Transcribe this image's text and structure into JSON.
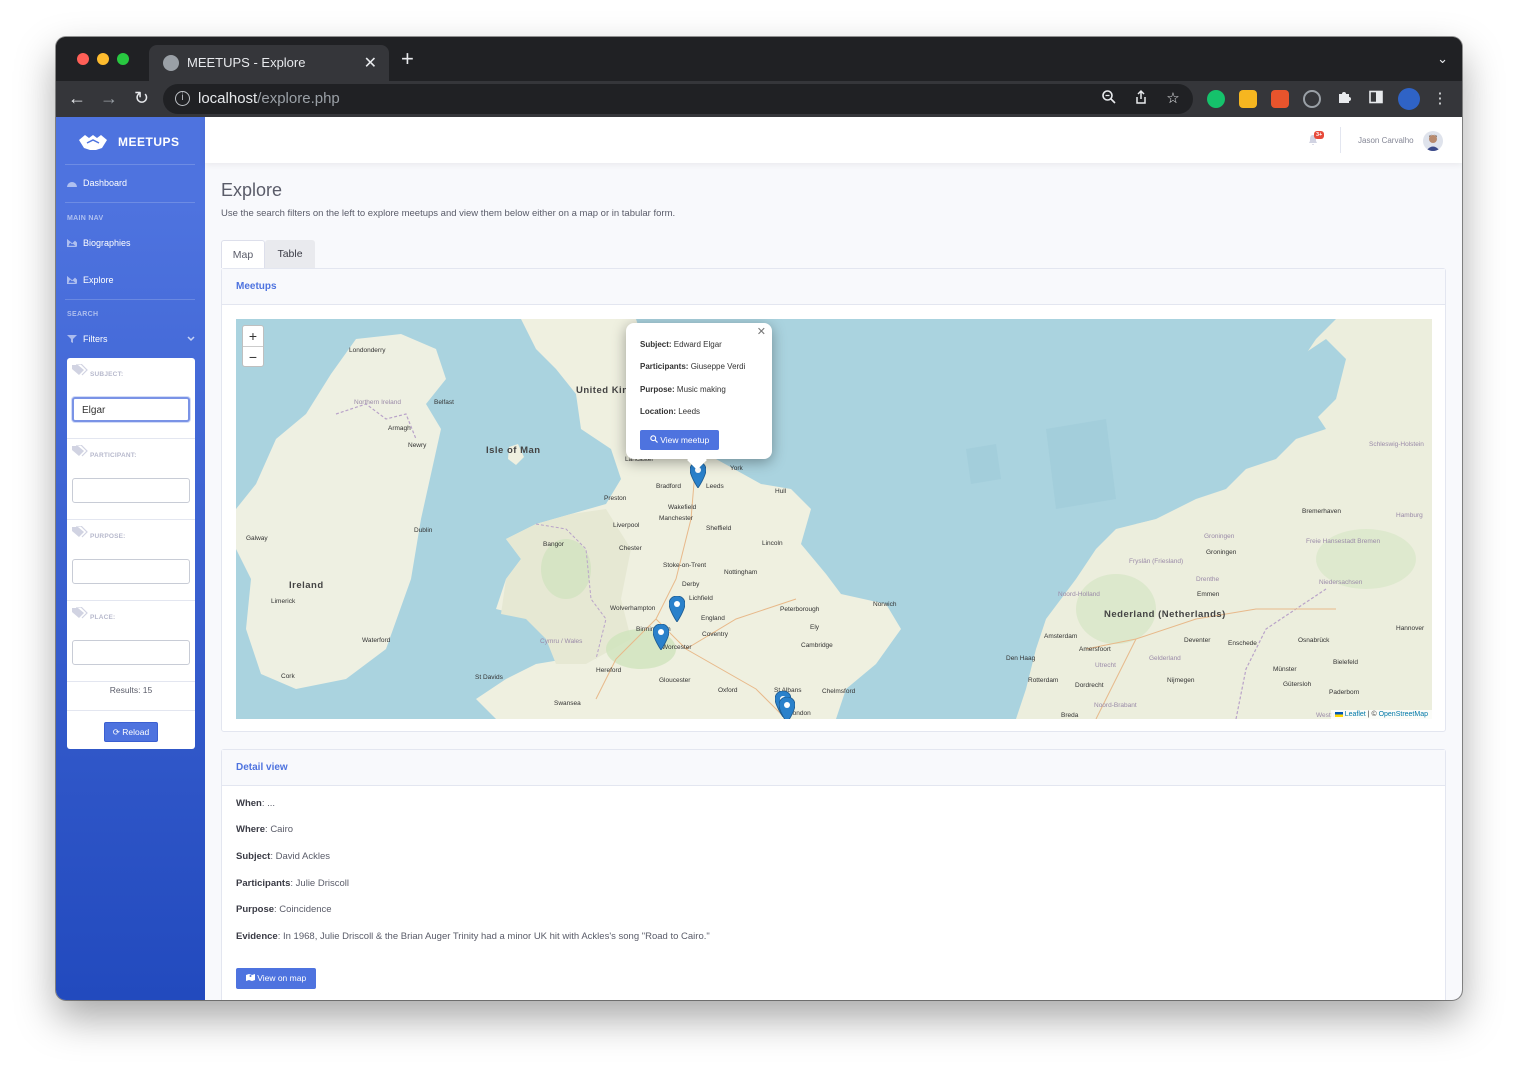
{
  "browser": {
    "tab_title": "MEETUPS - Explore",
    "url_host": "localhost",
    "url_path": "/explore.php"
  },
  "sidebar": {
    "brand": "MEETUPS",
    "dashboard": "Dashboard",
    "main_nav_heading": "MAIN NAV",
    "biographies": "Biographies",
    "explore": "Explore",
    "search_heading": "SEARCH",
    "filters": "Filters",
    "filter_fields": [
      {
        "label": "SUBJECT:",
        "value": "Elgar"
      },
      {
        "label": "PARTICIPANT:",
        "value": ""
      },
      {
        "label": "PURPOSE:",
        "value": ""
      },
      {
        "label": "PLACE:",
        "value": ""
      }
    ],
    "results": "Results: 15",
    "reload": "Reload"
  },
  "topbar": {
    "badge": "3+",
    "username": "Jason Carvalho"
  },
  "header": {
    "title": "Explore",
    "subtitle": "Use the search filters on the left to explore meetups and view them below either on a map or in tabular form."
  },
  "tabs": [
    "Map",
    "Table"
  ],
  "map_card": {
    "header": "Meetups",
    "popup": {
      "subject_label": "Subject:",
      "subject": "Edward Elgar",
      "participants_label": "Participants:",
      "participants": "Giuseppe Verdi",
      "purpose_label": "Purpose:",
      "purpose": "Music making",
      "location_label": "Location:",
      "location": "Leeds",
      "button": "View meetup"
    },
    "attribution": {
      "leaflet": "Leaflet",
      "sep": " | © ",
      "osm": "OpenStreetMap"
    },
    "places": {
      "united_kingdom": "United Kingdom",
      "isle_of_man": "Isle of Man",
      "ireland": "Ireland",
      "nederland": "Nederland (Netherlands)",
      "northern_ireland": "Northern Ireland",
      "londonderry": "Londonderry",
      "belfast": "Belfast",
      "armagh": "Armagh",
      "newry": "Newry",
      "dublin": "Dublin",
      "galway": "Galway",
      "limerick": "Limerick",
      "waterford": "Waterford",
      "cork": "Cork",
      "lancaster": "Lancaster",
      "york": "York",
      "bradford": "Bradford",
      "leeds": "Leeds",
      "preston": "Preston",
      "hull": "Hull",
      "wakefield": "Wakefield",
      "liverpool": "Liverpool",
      "manchester": "Manchester",
      "sheffield": "Sheffield",
      "bangor": "Bangor",
      "chester": "Chester",
      "lincoln": "Lincoln",
      "stoke": "Stoke-on-Trent",
      "nottingham": "Nottingham",
      "derby": "Derby",
      "lichfield": "Lichfield",
      "wolverhampton": "Wolverhampton",
      "peterborough": "Peterborough",
      "norwich": "Norwich",
      "england": "England",
      "birmingham": "Birmingham",
      "coventry": "Coventry",
      "ely": "Ely",
      "cymru": "Cymru / Wales",
      "worcester": "Worcester",
      "cambridge": "Cambridge",
      "hereford": "Hereford",
      "st_davids": "St Davids",
      "gloucester": "Gloucester",
      "oxford": "Oxford",
      "st_albans": "St Albans",
      "chelmsford": "Chelmsford",
      "swansea": "Swansea",
      "london": "London",
      "bremerhaven": "Bremerhaven",
      "groningen": "Groningen",
      "emmen": "Emmen",
      "amsterdam": "Amsterdam",
      "amersfoort": "Amersfoort",
      "deventer": "Deventer",
      "enschede": "Enschede",
      "den_haag": "Den Haag",
      "rotterdam": "Rotterdam",
      "utrecht": "Utrecht",
      "nijmegen": "Nijmegen",
      "dordrecht": "Dordrecht",
      "breda": "Breda",
      "munster": "Münster",
      "bielefeld": "Bielefeld",
      "osnabruck": "Osnabrück",
      "hannover": "Hannover",
      "paderborn": "Paderborn",
      "gutersloh": "Gütersloh",
      "schleswig": "Schleswig-Holstein",
      "hamburg": "Hamburg",
      "bremen": "Freie Hansestadt Bremen",
      "niedersachsen": "Niedersachsen",
      "noord_holland": "Noord-Holland",
      "gelderland": "Gelderland",
      "drenthe": "Drenthe",
      "friesland": "Fryslân (Friesland)",
      "noord_brabant": "Noord-Brabant",
      "westfalen": "Westfalen"
    }
  },
  "detail_card": {
    "header": "Detail view",
    "when_label": "When",
    "when": ": ...",
    "where_label": "Where",
    "where": ": Cairo",
    "subject_label": "Subject",
    "subject": ": David Ackles",
    "participants_label": "Participants",
    "participants": ": Julie Driscoll",
    "purpose_label": "Purpose",
    "purpose": ": Coincidence",
    "evidence_label": "Evidence",
    "evidence": ": In 1968, Julie Driscoll & the Brian Auger Trinity had a minor UK hit with Ackles's song \"Road to Cairo.\"",
    "button": "View on map"
  },
  "colors": {
    "primary": "#4e73df",
    "sidebar_dark": "#224abe",
    "sea": "#aad3df",
    "land": "#f2efe9",
    "marker": "#2a81cb",
    "badge": "#e74a3b"
  }
}
